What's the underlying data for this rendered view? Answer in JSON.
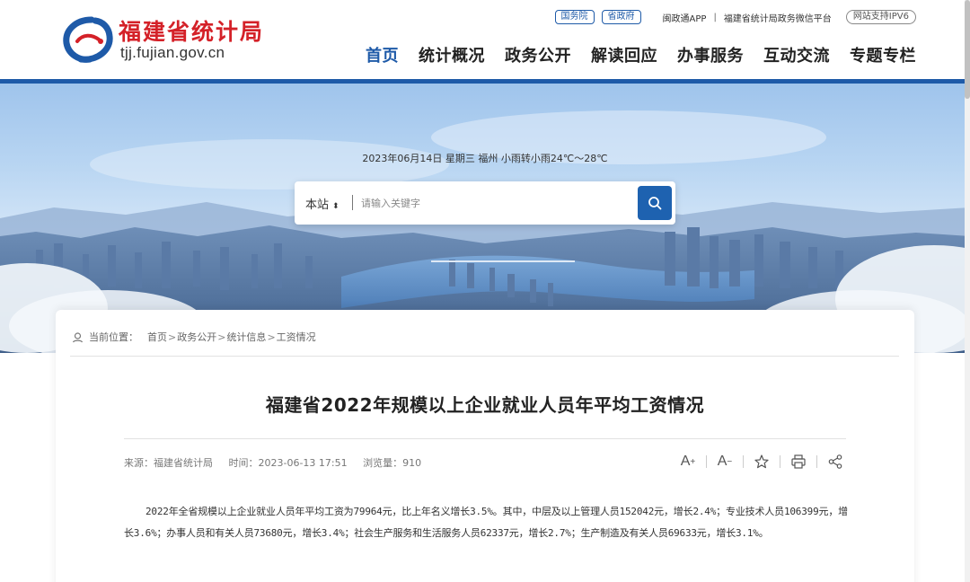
{
  "site": {
    "name": "福建省统计局",
    "domain": "tjj.fujian.gov.cn"
  },
  "topbar": {
    "gov_state": "国务院",
    "gov_province": "省政府",
    "app": "闽政通APP",
    "wechat": "福建省统计局政务微信平台",
    "ipv6": "网站支持IPV6"
  },
  "nav": {
    "items": [
      {
        "label": "首页"
      },
      {
        "label": "统计概况"
      },
      {
        "label": "政务公开"
      },
      {
        "label": "解读回应"
      },
      {
        "label": "办事服务"
      },
      {
        "label": "互动交流"
      },
      {
        "label": "专题专栏"
      }
    ]
  },
  "banner": {
    "weather": "2023年06月14日  星期三  福州 小雨转小雨24℃～28℃",
    "search": {
      "scope": "本站",
      "placeholder": "请输入关键字"
    }
  },
  "breadcrumb": {
    "label": "当前位置：",
    "items": [
      "首页",
      "政务公开",
      "统计信息",
      "工资情况"
    ],
    "separator": ">"
  },
  "article": {
    "title": "福建省2022年规模以上企业就业人员年平均工资情况",
    "source": "来源：福建省统计局",
    "time": "时间：2023-06-13 17:51",
    "views": "浏览量：910",
    "body": "2022年全省规模以上企业就业人员年平均工资为79964元，比上年名义增长3.5%。其中，中层及以上管理人员152042元，增长2.4%；专业技术人员106399元，增长3.6%；办事人员和有关人员73680元，增长3.4%；社会生产服务和生活服务人员62337元，增长2.7%；生产制造及有关人员69633元，增长3.1%。"
  },
  "tools": {
    "increase_font": "A",
    "decrease_font": "A",
    "plus": "+",
    "minus": "−"
  },
  "colors": {
    "brand_blue": "#1e5aa8",
    "brand_red": "#d42128"
  }
}
